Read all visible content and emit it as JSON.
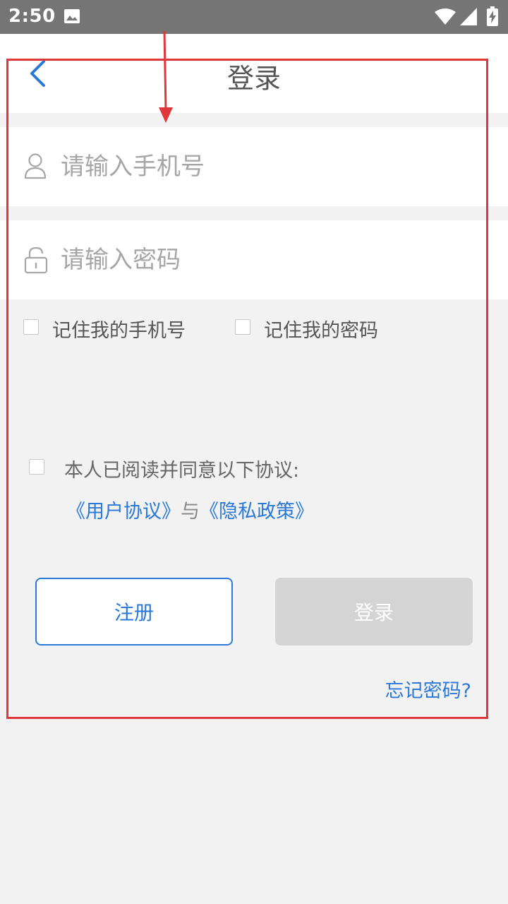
{
  "status_bar": {
    "time": "2:50",
    "icons": [
      "image-icon",
      "wifi-icon",
      "signal-icon",
      "battery-charging-icon"
    ]
  },
  "header": {
    "title": "登录",
    "back_icon": "chevron-left-icon"
  },
  "form": {
    "phone": {
      "placeholder": "请输入手机号",
      "value": "",
      "icon": "user-icon"
    },
    "password": {
      "placeholder": "请输入密码",
      "value": "",
      "icon": "lock-icon"
    },
    "remember_phone": {
      "label": "记住我的手机号",
      "checked": false
    },
    "remember_password": {
      "label": "记住我的密码",
      "checked": false
    }
  },
  "agreement": {
    "label": "本人已阅读并同意以下协议:",
    "checked": false,
    "user_agreement": "《用户协议》",
    "conjunction": "与",
    "privacy_policy": "《隐私政策》"
  },
  "buttons": {
    "register": "注册",
    "login": "登录",
    "forgot_password": "忘记密码?"
  },
  "colors": {
    "accent": "#2a78d8",
    "disabled_button": "#d4d4d4",
    "background": "#f2f2f2",
    "annotation": "#e0373d"
  }
}
